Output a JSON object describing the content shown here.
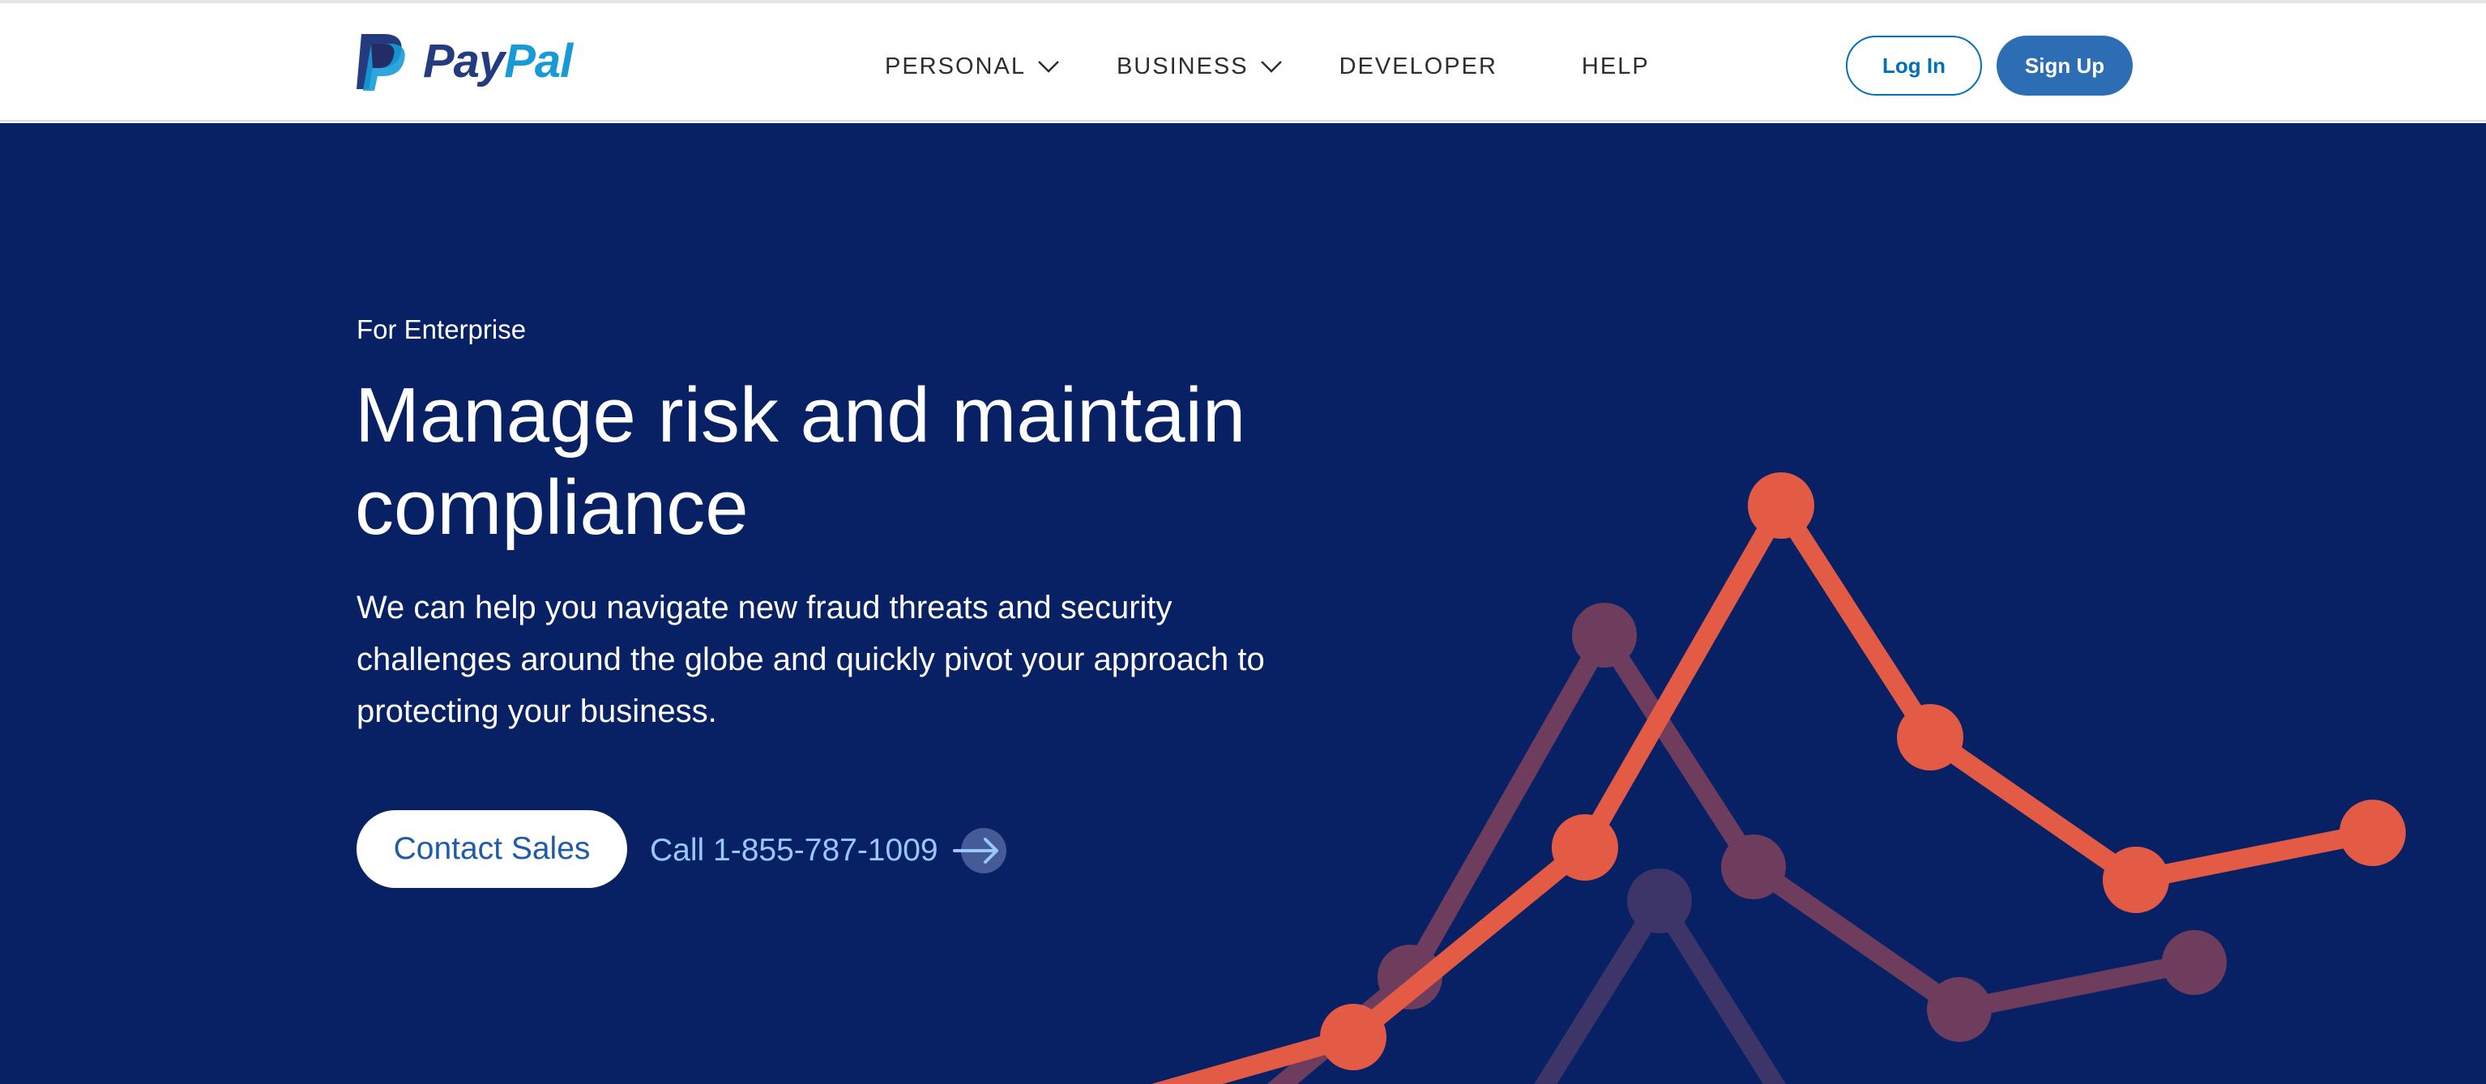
{
  "header": {
    "brand": {
      "pay": "Pay",
      "pal": "Pal"
    },
    "nav": [
      {
        "label": "PERSONAL",
        "icon": "chevron-down-icon"
      },
      {
        "label": "BUSINESS",
        "icon": "chevron-down-icon"
      },
      {
        "label": "DEVELOPER"
      },
      {
        "label": "HELP"
      }
    ],
    "login_label": "Log In",
    "signup_label": "Sign Up"
  },
  "hero": {
    "eyebrow": "For Enterprise",
    "headline": "Manage risk and maintain compliance",
    "description": "We can help you navigate new fraud threats and security challenges around the globe and quickly pivot your approach to protecting your business.",
    "primary_cta": "Contact Sales",
    "phone_link": "Call 1-855-787-1009",
    "phone_icon": "arrow-right-icon"
  },
  "colors": {
    "nav_background": "#ffffff",
    "hero_background": "#082164",
    "brand_dark": "#253b80",
    "brand_light": "#179bd7",
    "signup_button": "#2c6db3",
    "login_border": "#0070ba",
    "accent_line": "#e35b45",
    "muted_line": "#6e3d5e",
    "faint_line": "#3d3468",
    "phone_link": "#99c8ff"
  }
}
